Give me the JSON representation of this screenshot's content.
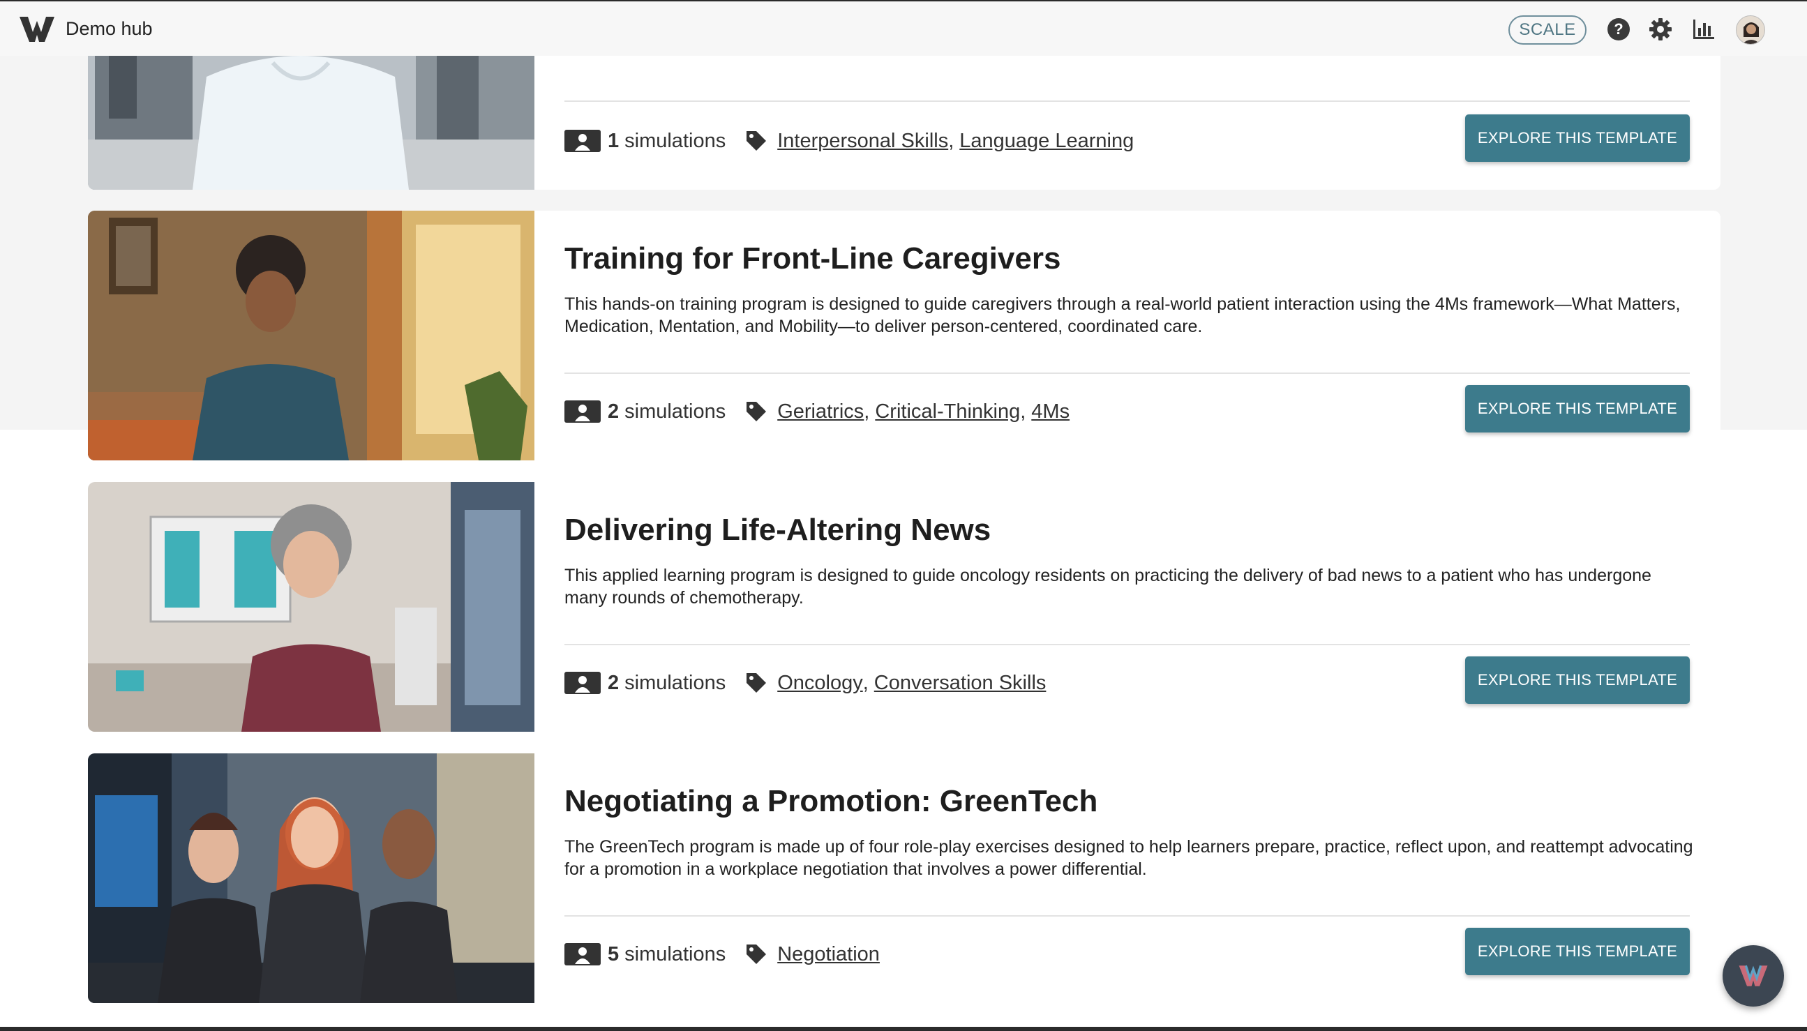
{
  "app": {
    "title": "Demo hub",
    "scale_label": "SCALE"
  },
  "icons": {
    "logo": "w-logo-icon",
    "help": "help-icon",
    "settings": "gear-icon",
    "analytics": "bar-chart-icon",
    "avatar": "user-avatar",
    "simulations": "id-card-icon",
    "tags": "tag-icon",
    "fab": "w-logo-fab-icon"
  },
  "colors": {
    "accent": "#3d7b8c",
    "scale_border": "#6f8f9c",
    "fab": "#3c4652"
  },
  "templates": [
    {
      "title": "",
      "description": "",
      "sim_count": "1",
      "sim_word": "simulations",
      "tags": [
        "Interpersonal Skills",
        "Language Learning"
      ],
      "button": "EXPLORE THIS TEMPLATE"
    },
    {
      "title": "Training for Front-Line Caregivers",
      "description": "This hands-on training program is designed to guide caregivers through a real-world patient interaction using the 4Ms framework—What Matters, Medication, Mentation, and Mobility—to deliver person-centered, coordinated care.",
      "sim_count": "2",
      "sim_word": "simulations",
      "tags": [
        "Geriatrics",
        "Critical-Thinking",
        "4Ms"
      ],
      "button": "EXPLORE THIS TEMPLATE"
    },
    {
      "title": "Delivering Life-Altering News",
      "description": "This applied learning program is designed to guide oncology residents on practicing the delivery of bad news to a patient who has undergone many rounds of chemotherapy.",
      "sim_count": "2",
      "sim_word": "simulations",
      "tags": [
        "Oncology",
        "Conversation Skills"
      ],
      "button": "EXPLORE THIS TEMPLATE"
    },
    {
      "title": "Negotiating a Promotion: GreenTech",
      "description": "The GreenTech program is made up of four role-play exercises designed to help learners prepare, practice, reflect upon, and reattempt advocating for a promotion in a workplace negotiation that involves a power differential.",
      "sim_count": "5",
      "sim_word": "simulations",
      "tags": [
        "Negotiation"
      ],
      "button": "EXPLORE THIS TEMPLATE"
    }
  ]
}
